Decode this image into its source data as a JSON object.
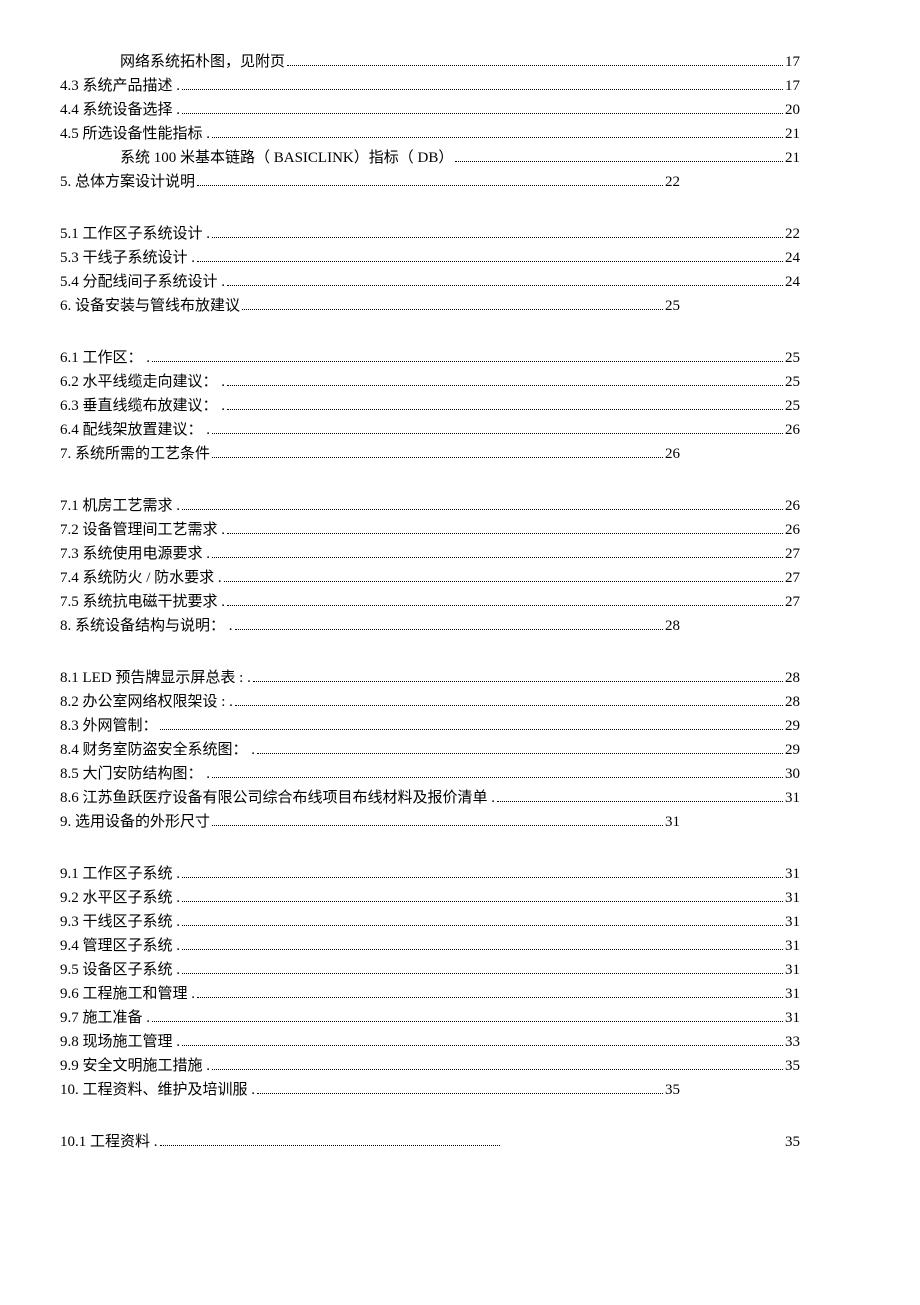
{
  "entries": [
    {
      "indent": 1,
      "label": "网络系统拓朴图，见附页",
      "page": "17",
      "style": "standard"
    },
    {
      "indent": 0,
      "label": "4.3 系统产品描述 .",
      "page": "17",
      "style": "standard"
    },
    {
      "indent": 0,
      "label": "4.4 系统设备选择 .",
      "page": "20",
      "style": "standard"
    },
    {
      "indent": 0,
      "label": "4.5 所选设备性能指标  .",
      "page": "21",
      "style": "standard"
    },
    {
      "indent": 1,
      "label": "系统 100 米基本链路（ BASICLINK）指标（ DB）",
      "page": "21",
      "style": "standard"
    },
    {
      "indent": 0,
      "label": "5. 总体方案设计说明",
      "page": "22",
      "style": "short",
      "gap_after": true
    },
    {
      "indent": 0,
      "label": "5.1 工作区子系统设计  .",
      "page": "22",
      "style": "standard"
    },
    {
      "indent": 0,
      "label": "5.3 干线子系统设计 .",
      "page": "24",
      "style": "standard"
    },
    {
      "indent": 0,
      "label": "5.4 分配线间子系统设计   .",
      "page": "24",
      "style": "standard"
    },
    {
      "indent": 0,
      "label": "6. 设备安装与管线布放建议",
      "page": "25",
      "style": "short",
      "gap_after": true
    },
    {
      "indent": 0,
      "label": "6.1 工作区：  .",
      "page": "25",
      "style": "standard"
    },
    {
      "indent": 0,
      "label": "6.2  水平线缆走向建议： .",
      "page": "25",
      "style": "standard"
    },
    {
      "indent": 0,
      "label": "6.3 垂直线缆布放建议：   .",
      "page": "25",
      "style": "standard"
    },
    {
      "indent": 0,
      "label": "6.4 配线架放置建议：   .",
      "page": "26",
      "style": "standard"
    },
    {
      "indent": 0,
      "label": "7. 系统所需的工艺条件",
      "page": "26",
      "style": "short",
      "gap_after": true
    },
    {
      "indent": 0,
      "label": "7.1 机房工艺需求 .",
      "page": "26",
      "style": "standard"
    },
    {
      "indent": 0,
      "label": "7.2 设备管理间工艺需求   .",
      "page": "26",
      "style": "standard"
    },
    {
      "indent": 0,
      "label": "7.3 系统使用电源要求  .",
      "page": "27",
      "style": "standard"
    },
    {
      "indent": 0,
      "label": "7.4 系统防火 / 防水要求 .",
      "page": "27",
      "style": "standard"
    },
    {
      "indent": 0,
      "label": "7.5 系统抗电磁干扰要求   .",
      "page": "27",
      "style": "standard"
    },
    {
      "indent": 0,
      "label": "8. 系统设备结构与说明：  .",
      "page": "28",
      "style": "short",
      "gap_after": true
    },
    {
      "indent": 0,
      "label": "8.1  LED 预告牌显示屏总表 : .",
      "page": "28",
      "style": "standard"
    },
    {
      "indent": 0,
      "label": "8.2 办公室网络权限架设 : .",
      "page": "28",
      "style": "standard"
    },
    {
      "indent": 0,
      "label": "8.3  外网管制：",
      "page": "29",
      "style": "standard"
    },
    {
      "indent": 0,
      "label": "8.4 财务室防盗安全系统图：   .",
      "page": "29",
      "style": "standard"
    },
    {
      "indent": 0,
      "label": "8.5 大门安防结构图：   .",
      "page": "30",
      "style": "standard"
    },
    {
      "indent": 0,
      "label": "8.6 江苏鱼跃医疗设备有限公司综合布线项目布线材料及报价清单    .",
      "page": "31",
      "style": "standard"
    },
    {
      "indent": 0,
      "label": "9. 选用设备的外形尺寸",
      "page": "31",
      "style": "short",
      "gap_after": true
    },
    {
      "indent": 0,
      "label": "9.1 工作区子系统 .",
      "page": "31",
      "style": "standard"
    },
    {
      "indent": 0,
      "label": "9.2 水平区子系统 .",
      "page": "31",
      "style": "standard"
    },
    {
      "indent": 0,
      "label": "9.3 干线区子系统 .",
      "page": "31",
      "style": "standard"
    },
    {
      "indent": 0,
      "label": "9.4 管理区子系统 .",
      "page": "31",
      "style": "standard"
    },
    {
      "indent": 0,
      "label": "9.5 设备区子系统 .",
      "page": "31",
      "style": "standard"
    },
    {
      "indent": 0,
      "label": "9.6 工程施工和管理 .",
      "page": "31",
      "style": "standard"
    },
    {
      "indent": 0,
      "label": "9.7 施工准备 .",
      "page": "31",
      "style": "standard"
    },
    {
      "indent": 0,
      "label": "9.8 现场施工管理 .",
      "page": "33",
      "style": "standard"
    },
    {
      "indent": 0,
      "label": "9.9 安全文明施工措施  .",
      "page": "35",
      "style": "standard"
    },
    {
      "indent": 0,
      "label": "10. 工程资料、维护及培训服  .",
      "page": "35",
      "style": "short",
      "gap_after": true
    },
    {
      "indent": 0,
      "label": "10.1 工程资料 . ",
      "page": "35",
      "style": "special"
    }
  ]
}
